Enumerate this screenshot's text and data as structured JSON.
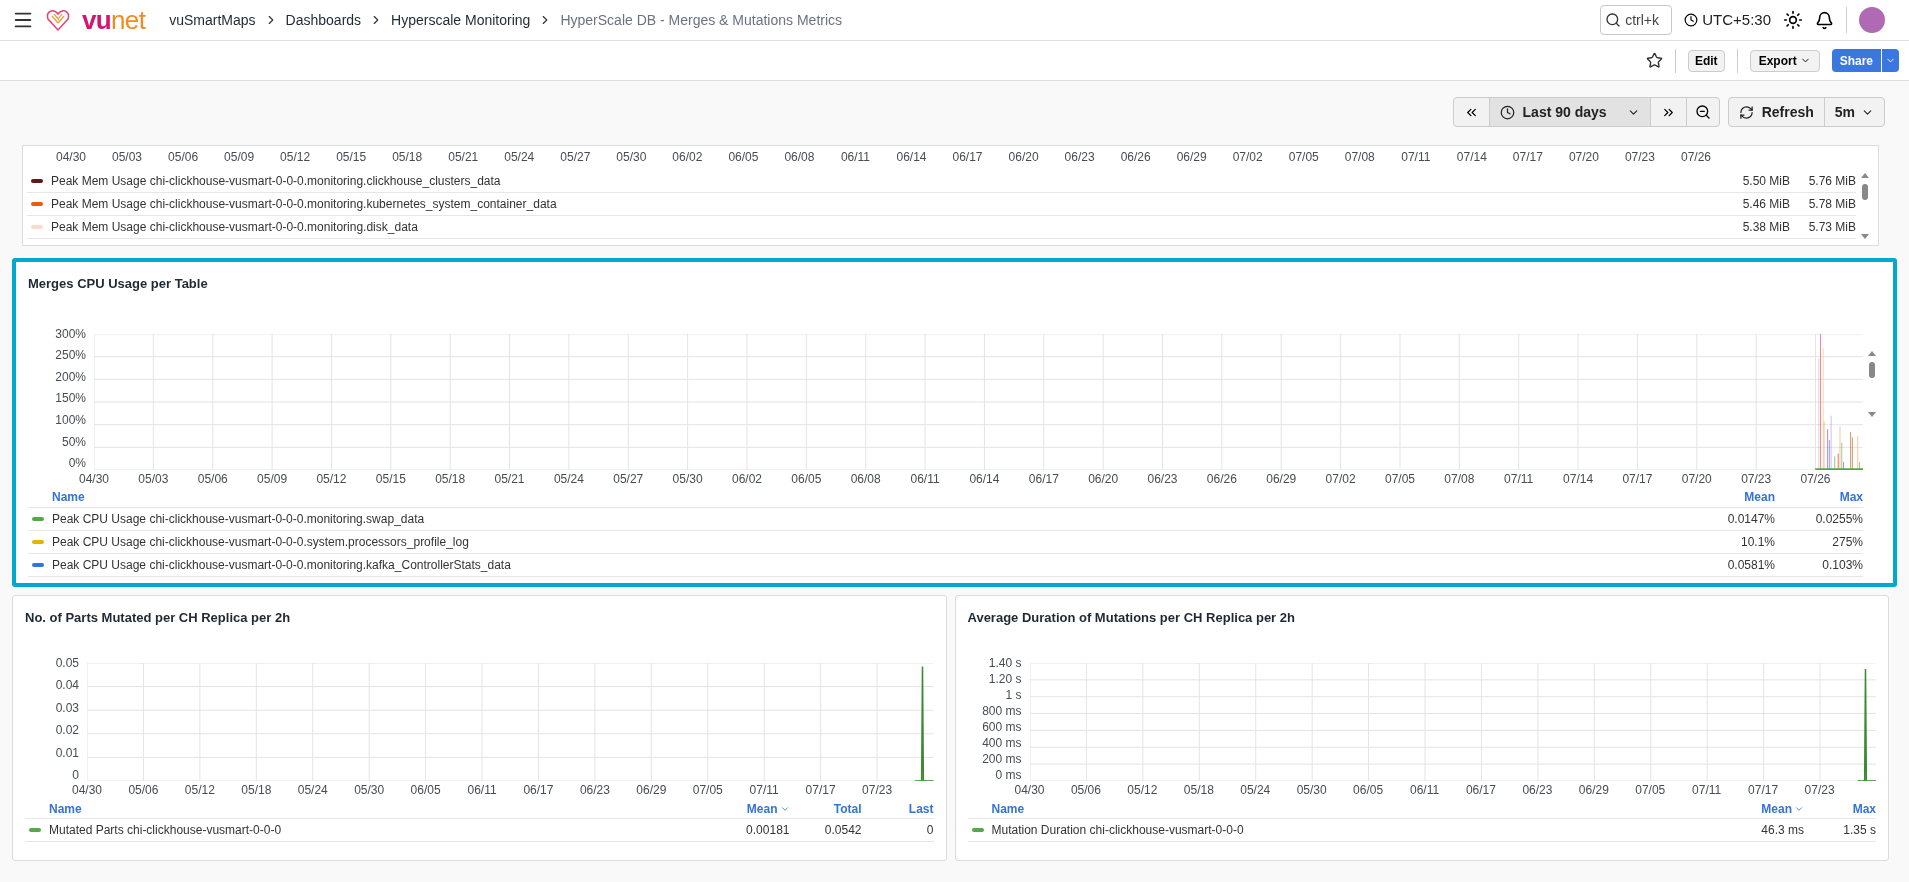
{
  "topbar": {
    "logo_text": [
      "vu",
      "net"
    ],
    "breadcrumbs": [
      {
        "label": "vuSmartMaps",
        "current": false
      },
      {
        "label": "Dashboards",
        "current": false
      },
      {
        "label": "Hyperscale Monitoring",
        "current": false
      },
      {
        "label": "HyperScale DB - Merges & Mutations Metrics",
        "current": true
      }
    ],
    "search": {
      "placeholder": "ctrl+k"
    },
    "timezone": "UTC+5:30"
  },
  "toolbar": {
    "edit": "Edit",
    "export": "Export",
    "share": "Share"
  },
  "time_controls": {
    "range": "Last 90 days",
    "refresh": "Refresh",
    "interval": "5m"
  },
  "panels": [
    {
      "kind": "partial",
      "x_labels": [
        "04/30",
        "05/03",
        "05/06",
        "05/09",
        "05/12",
        "05/15",
        "05/18",
        "05/21",
        "05/24",
        "05/27",
        "05/30",
        "06/02",
        "06/05",
        "06/08",
        "06/11",
        "06/14",
        "06/17",
        "06/20",
        "06/23",
        "06/26",
        "06/29",
        "07/02",
        "07/05",
        "07/08",
        "07/11",
        "07/14",
        "07/17",
        "07/20",
        "07/23",
        "07/26"
      ],
      "rows": [
        {
          "name": "Peak Mem Usage chi-clickhouse-vusmart-0-0-0.monitoring.clickhouse_clusters_data",
          "color": "#5c1a1a",
          "values": [
            "5.50 MiB",
            "5.76 MiB"
          ]
        },
        {
          "name": "Peak Mem Usage chi-clickhouse-vusmart-0-0-0.monitoring.kubernetes_system_container_data",
          "color": "#f2590a",
          "values": [
            "5.46 MiB",
            "5.78 MiB"
          ]
        },
        {
          "name": "Peak Mem Usage chi-clickhouse-vusmart-0-0-0.monitoring.disk_data",
          "color": "#fbdcc9",
          "values": [
            "5.38 MiB",
            "5.73 MiB"
          ]
        }
      ]
    },
    {
      "kind": "wide",
      "title": "Merges CPU Usage per Table",
      "highlighted": true,
      "y_labels": [
        "300%",
        "250%",
        "200%",
        "150%",
        "100%",
        "50%",
        "0%"
      ],
      "x_labels": [
        "04/30",
        "05/03",
        "05/06",
        "05/09",
        "05/12",
        "05/15",
        "05/18",
        "05/21",
        "05/24",
        "05/27",
        "05/30",
        "06/02",
        "06/05",
        "06/08",
        "06/11",
        "06/14",
        "06/17",
        "06/20",
        "06/23",
        "06/26",
        "06/29",
        "07/02",
        "07/05",
        "07/08",
        "07/11",
        "07/14",
        "07/17",
        "07/20",
        "07/23",
        "07/26"
      ],
      "columns": [
        {
          "label": "Name",
          "sorted": false
        },
        {
          "label": "Mean",
          "sorted": false
        },
        {
          "label": "Max",
          "sorted": false
        }
      ],
      "rows": [
        {
          "name": "Peak CPU Usage chi-clickhouse-vusmart-0-0-0.monitoring.swap_data",
          "color": "#56a64b",
          "values": [
            "0.0147%",
            "0.0255%"
          ]
        },
        {
          "name": "Peak CPU Usage chi-clickhouse-vusmart-0-0-0.system.processors_profile_log",
          "color": "#e0b400",
          "values": [
            "10.1%",
            "275%"
          ]
        },
        {
          "name": "Peak CPU Usage chi-clickhouse-vusmart-0-0-0.monitoring.kafka_ControllerStats_data",
          "color": "#3274d9",
          "values": [
            "0.0581%",
            "0.103%"
          ]
        }
      ]
    },
    {
      "kind": "half",
      "title": "No. of Parts Mutated per CH Replica per 2h",
      "highlighted": false,
      "y_labels": [
        "0.05",
        "0.04",
        "0.03",
        "0.02",
        "0.01",
        "0"
      ],
      "x_labels": [
        "04/30",
        "05/06",
        "05/12",
        "05/18",
        "05/24",
        "05/30",
        "06/05",
        "06/11",
        "06/17",
        "06/23",
        "06/29",
        "07/05",
        "07/11",
        "07/17",
        "07/23"
      ],
      "columns": [
        {
          "label": "Name",
          "sorted": false
        },
        {
          "label": "Mean",
          "sorted": true
        },
        {
          "label": "Total",
          "sorted": false
        },
        {
          "label": "Last",
          "sorted": false
        }
      ],
      "rows": [
        {
          "name": "Mutated Parts chi-clickhouse-vusmart-0-0-0",
          "color": "#56a64b",
          "values": [
            "0.00181",
            "0.0542",
            "0"
          ]
        }
      ]
    },
    {
      "kind": "half",
      "title": "Average Duration of Mutations per CH Replica per 2h",
      "highlighted": false,
      "y_labels": [
        "1.40 s",
        "1.20 s",
        "1 s",
        "800 ms",
        "600 ms",
        "400 ms",
        "200 ms",
        "0 ms"
      ],
      "x_labels": [
        "04/30",
        "05/06",
        "05/12",
        "05/18",
        "05/24",
        "05/30",
        "06/05",
        "06/11",
        "06/17",
        "06/23",
        "06/29",
        "07/05",
        "07/11",
        "07/17",
        "07/23"
      ],
      "columns": [
        {
          "label": "Name",
          "sorted": false
        },
        {
          "label": "Mean",
          "sorted": true
        },
        {
          "label": "Max",
          "sorted": false
        }
      ],
      "rows": [
        {
          "name": "Mutation Duration chi-clickhouse-vusmart-0-0-0",
          "color": "#56a64b",
          "values": [
            "46.3 ms",
            "1.35 s"
          ]
        }
      ]
    }
  ]
}
